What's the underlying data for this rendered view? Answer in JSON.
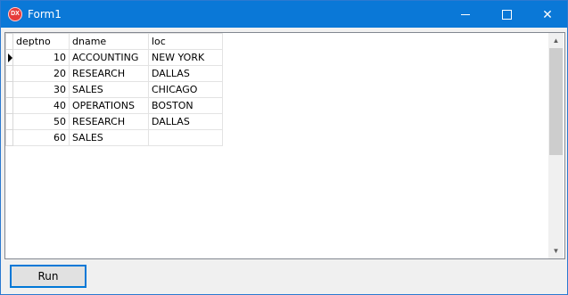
{
  "window": {
    "title": "Form1",
    "icon_text": "DX",
    "accent_color": "#0a78d7",
    "icons": {
      "minimize": "minimize-icon",
      "maximize": "maximize-icon",
      "close": "close-icon"
    }
  },
  "grid": {
    "columns": [
      "deptno",
      "dname",
      "loc"
    ],
    "selected_row": 0,
    "rows": [
      {
        "deptno": "10",
        "dname": "ACCOUNTING",
        "loc": "NEW YORK"
      },
      {
        "deptno": "20",
        "dname": "RESEARCH",
        "loc": "DALLAS"
      },
      {
        "deptno": "30",
        "dname": "SALES",
        "loc": "CHICAGO"
      },
      {
        "deptno": "40",
        "dname": "OPERATIONS",
        "loc": "BOSTON"
      },
      {
        "deptno": "50",
        "dname": "RESEARCH",
        "loc": "DALLAS"
      },
      {
        "deptno": "60",
        "dname": "SALES",
        "loc": ""
      }
    ]
  },
  "actions": {
    "run_label": "Run"
  }
}
